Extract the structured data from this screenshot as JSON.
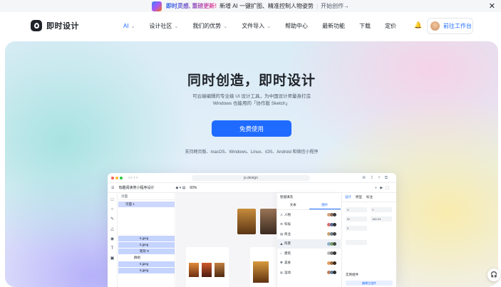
{
  "banner": {
    "highlight": "即时灵感, 重磅更新!",
    "text": "新增 AI 一键扩图、精准控制人物姿势",
    "separator": "|",
    "link": "开始创作→",
    "close": "✕"
  },
  "logo": {
    "name": "即时设计"
  },
  "nav": {
    "items": [
      "AI",
      "设计社区",
      "我们的优势",
      "文件导入",
      "帮助中心",
      "最新功能",
      "下载",
      "定价"
    ],
    "workspace": "前往工作台"
  },
  "hero": {
    "title": "同时创造，即时设计",
    "subtitle_line1": "可云端编辑的专业级 UI 设计工具，为中国设计师量身打造",
    "subtitle_line2": "Windows 也能用的「协作版 Sketch」",
    "cta": "免费使用",
    "platforms": "支持网页版、macOS、Windows、Linux、iOS、Android 和微信小程序"
  },
  "app": {
    "address": "js.design",
    "file_title": "有趣阅读类小程序设计",
    "zoom": "60%",
    "layers_header": "页面",
    "selected_layer": "页面 1",
    "layer_rows": [
      "5.jpeg",
      "5.jpeg",
      "矩形 8",
      "群组",
      "5.jpeg",
      "5.jpeg"
    ],
    "panel_title": "智能填充",
    "panel_tabs": [
      "文本",
      "图片"
    ],
    "categories": [
      "人物",
      "科技",
      "商业",
      "风景",
      "建筑",
      "美食",
      "运动"
    ],
    "props_tabs": [
      "设计",
      "原型",
      "标注"
    ],
    "fields": [
      "X",
      "Y",
      "W",
      "H",
      "180.34",
      "0"
    ],
    "component_label": "实例组件",
    "edit_button": "编辑主组件"
  },
  "help": {
    "icon": "headset-icon"
  },
  "colors": {
    "primary": "#1f6bff",
    "text": "#1f2329"
  }
}
